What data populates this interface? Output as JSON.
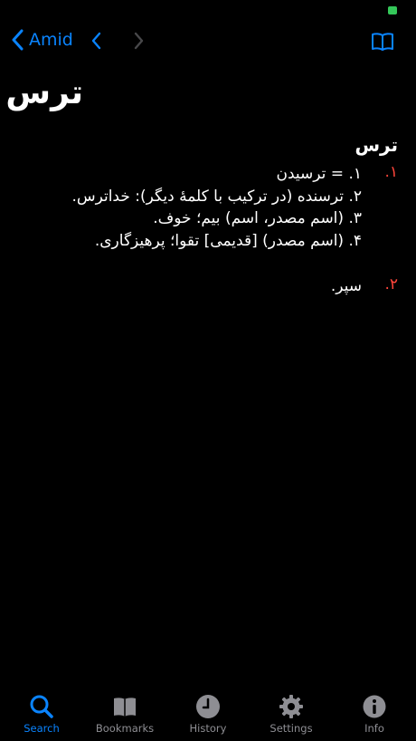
{
  "navbar": {
    "back_label": "Amid"
  },
  "entry": {
    "title": "ترس",
    "headword": "ترس",
    "senses": [
      {
        "number": "۱.",
        "lines": [
          "۱. = ترسیدن",
          "۲. ترسنده (در ترکیب با کلمهٔ دیگر): خداترس.",
          "۳. (اسم مصدر، اسم) بیم؛ خوف.",
          "۴. (اسم مصدر) [قدیمی] تقوا؛ پرهیزگاری."
        ]
      },
      {
        "number": "۲.",
        "lines": [
          "سپر."
        ]
      }
    ]
  },
  "tabs": [
    {
      "label": "Search",
      "icon": "magnifier-icon"
    },
    {
      "label": "Bookmarks",
      "icon": "book-icon"
    },
    {
      "label": "History",
      "icon": "clock-icon"
    },
    {
      "label": "Settings",
      "icon": "gear-icon"
    },
    {
      "label": "Info",
      "icon": "info-icon"
    }
  ],
  "colors": {
    "accent": "#0a84ff",
    "sense_number": "#ff453a",
    "inactive_tab": "#8e8e93",
    "background": "#000000"
  }
}
